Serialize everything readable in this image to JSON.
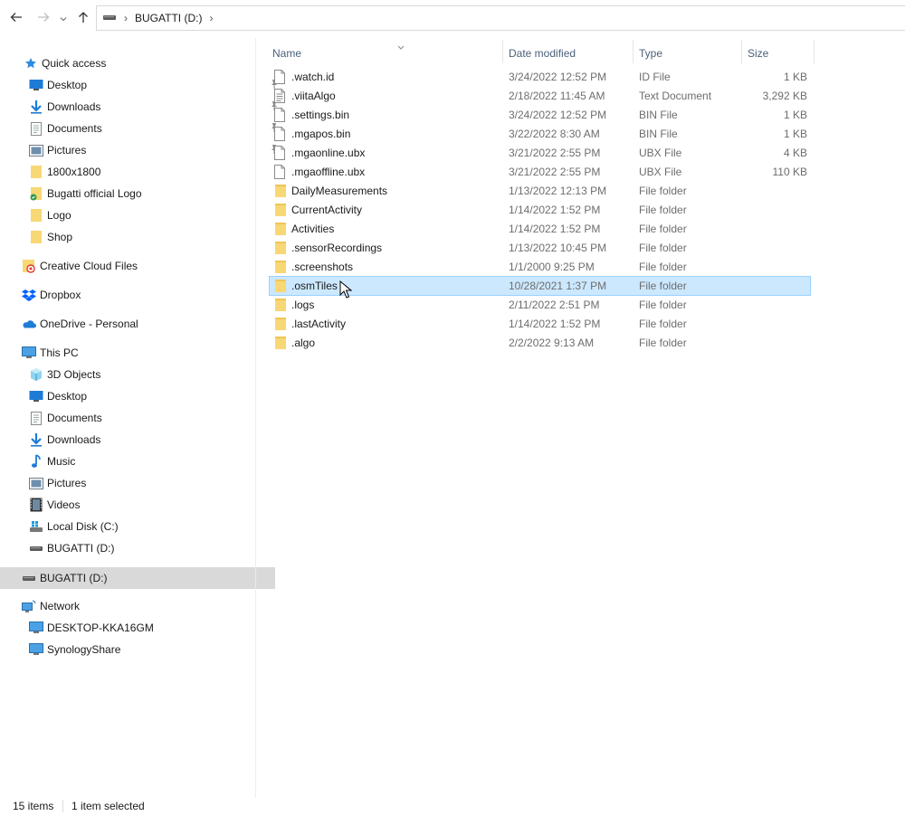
{
  "address": {
    "drive_icon": "drive-icon",
    "path": [
      "BUGATTI (D:)"
    ]
  },
  "nav": {
    "items": [
      {
        "label": "Quick access",
        "icon": "star-icon",
        "pinned": false,
        "selected": false
      },
      {
        "label": "Desktop",
        "icon": "desktop-folder-icon",
        "pinned": true,
        "selected": false
      },
      {
        "label": "Downloads",
        "icon": "download-icon",
        "pinned": true,
        "selected": false
      },
      {
        "label": "Documents",
        "icon": "documents-icon",
        "pinned": true,
        "selected": false
      },
      {
        "label": "Pictures",
        "icon": "pictures-icon",
        "pinned": true,
        "selected": false
      },
      {
        "label": "1800x1800",
        "icon": "folder-icon",
        "pinned": false,
        "selected": false
      },
      {
        "label": "Bugatti official Logo",
        "icon": "folder-synced-icon",
        "pinned": false,
        "selected": false
      },
      {
        "label": "Logo",
        "icon": "folder-icon",
        "pinned": false,
        "selected": false
      },
      {
        "label": "Shop",
        "icon": "folder-icon",
        "pinned": false,
        "selected": false
      },
      {
        "label": "Creative Cloud Files",
        "icon": "creative-cloud-icon",
        "pinned": false,
        "selected": false
      },
      {
        "label": "Dropbox",
        "icon": "dropbox-icon",
        "pinned": false,
        "selected": false
      },
      {
        "label": "OneDrive - Personal",
        "icon": "onedrive-icon",
        "pinned": false,
        "selected": false
      },
      {
        "label": "This PC",
        "icon": "computer-icon",
        "pinned": false,
        "selected": false
      },
      {
        "label": "3D Objects",
        "icon": "3d-objects-icon",
        "pinned": false,
        "selected": false
      },
      {
        "label": "Desktop",
        "icon": "desktop-folder-icon",
        "pinned": false,
        "selected": false
      },
      {
        "label": "Documents",
        "icon": "documents-icon",
        "pinned": false,
        "selected": false
      },
      {
        "label": "Downloads",
        "icon": "download-icon",
        "pinned": false,
        "selected": false
      },
      {
        "label": "Music",
        "icon": "music-icon",
        "pinned": false,
        "selected": false
      },
      {
        "label": "Pictures",
        "icon": "pictures-icon",
        "pinned": false,
        "selected": false
      },
      {
        "label": "Videos",
        "icon": "videos-icon",
        "pinned": false,
        "selected": false
      },
      {
        "label": "Local Disk (C:)",
        "icon": "windows-drive-icon",
        "pinned": false,
        "selected": false
      },
      {
        "label": "BUGATTI (D:)",
        "icon": "drive-icon",
        "pinned": false,
        "selected": false
      },
      {
        "label": "BUGATTI (D:)",
        "icon": "drive-icon",
        "pinned": false,
        "selected": true
      },
      {
        "label": "Network",
        "icon": "network-icon",
        "pinned": false,
        "selected": false
      },
      {
        "label": "DESKTOP-KKA16GM",
        "icon": "computer-icon",
        "pinned": false,
        "selected": false
      },
      {
        "label": "SynologyShare",
        "icon": "computer-icon",
        "pinned": false,
        "selected": false
      }
    ]
  },
  "columns": {
    "name": "Name",
    "date": "Date modified",
    "type": "Type",
    "size": "Size"
  },
  "files": [
    {
      "name": ".watch.id",
      "date": "3/24/2022 12:52 PM",
      "type": "ID File",
      "size": "1 KB",
      "kind": "file",
      "selected": false
    },
    {
      "name": ".viitaAlgo",
      "date": "2/18/2022 11:45 AM",
      "type": "Text Document",
      "size": "3,292 KB",
      "kind": "text",
      "selected": false
    },
    {
      "name": ".settings.bin",
      "date": "3/24/2022 12:52 PM",
      "type": "BIN File",
      "size": "1 KB",
      "kind": "file",
      "selected": false
    },
    {
      "name": ".mgapos.bin",
      "date": "3/22/2022 8:30 AM",
      "type": "BIN File",
      "size": "1 KB",
      "kind": "file",
      "selected": false
    },
    {
      "name": ".mgaonline.ubx",
      "date": "3/21/2022 2:55 PM",
      "type": "UBX File",
      "size": "4 KB",
      "kind": "file",
      "selected": false
    },
    {
      "name": ".mgaoffline.ubx",
      "date": "3/21/2022 2:55 PM",
      "type": "UBX File",
      "size": "110 KB",
      "kind": "file",
      "selected": false
    },
    {
      "name": "DailyMeasurements",
      "date": "1/13/2022 12:13 PM",
      "type": "File folder",
      "size": "",
      "kind": "folder",
      "selected": false
    },
    {
      "name": "CurrentActivity",
      "date": "1/14/2022 1:52 PM",
      "type": "File folder",
      "size": "",
      "kind": "folder",
      "selected": false
    },
    {
      "name": "Activities",
      "date": "1/14/2022 1:52 PM",
      "type": "File folder",
      "size": "",
      "kind": "folder",
      "selected": false
    },
    {
      "name": ".sensorRecordings",
      "date": "1/13/2022 10:45 PM",
      "type": "File folder",
      "size": "",
      "kind": "folder",
      "selected": false
    },
    {
      "name": ".screenshots",
      "date": "1/1/2000 9:25 PM",
      "type": "File folder",
      "size": "",
      "kind": "folder",
      "selected": false
    },
    {
      "name": ".osmTiles",
      "date": "10/28/2021 1:37 PM",
      "type": "File folder",
      "size": "",
      "kind": "folder",
      "selected": true
    },
    {
      "name": ".logs",
      "date": "2/11/2022 2:51 PM",
      "type": "File folder",
      "size": "",
      "kind": "folder",
      "selected": false
    },
    {
      "name": ".lastActivity",
      "date": "1/14/2022 1:52 PM",
      "type": "File folder",
      "size": "",
      "kind": "folder",
      "selected": false
    },
    {
      "name": ".algo",
      "date": "2/2/2022 9:13 AM",
      "type": "File folder",
      "size": "",
      "kind": "folder",
      "selected": false
    }
  ],
  "status": {
    "items_count": "15 items",
    "selection": "1 item selected"
  },
  "colors": {
    "selection_bg": "#cce8ff",
    "selection_border": "#99d1ff",
    "nav_selected_bg": "#d9d9d9",
    "folder": "#f8d775",
    "accent_blue": "#1e7bd6"
  }
}
